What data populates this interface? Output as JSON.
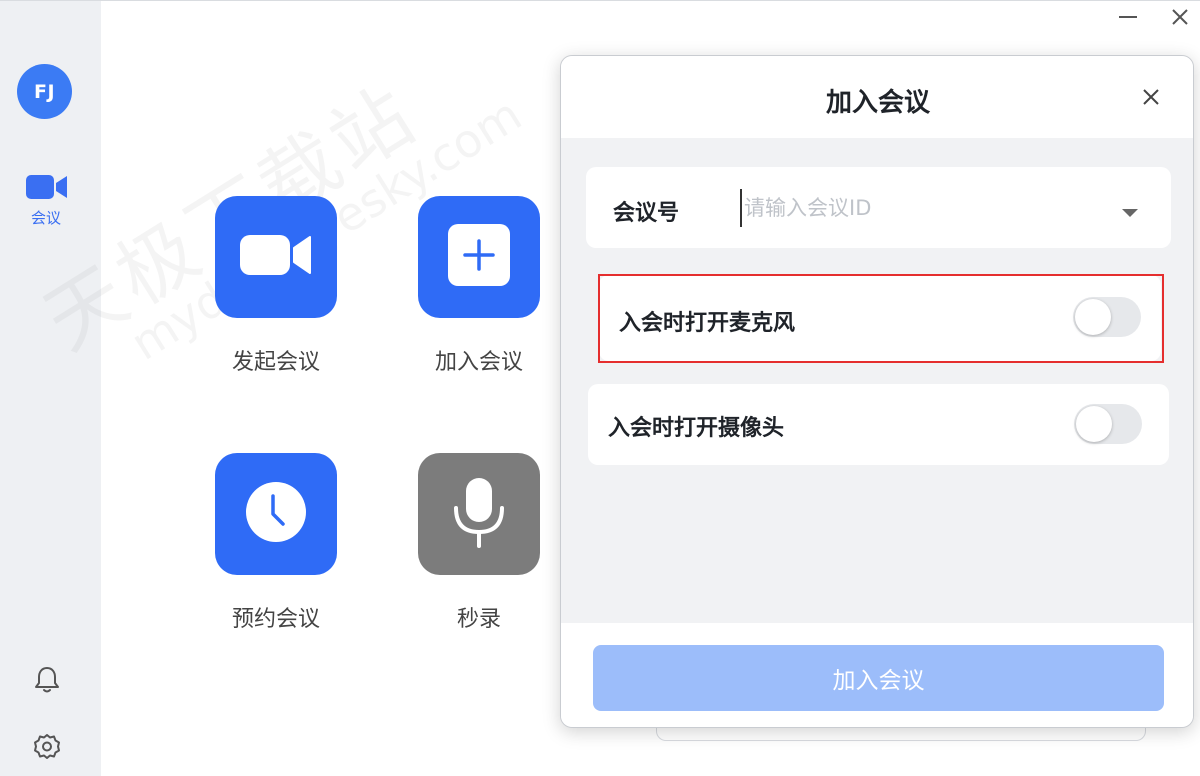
{
  "sidebar": {
    "avatar_initials": "FJ",
    "nav_meeting_label": "会议",
    "accent_color": "#3a6ff2",
    "icons": [
      "video-camera-icon",
      "bell-icon",
      "gear-icon"
    ]
  },
  "window_controls": [
    "minimize-icon",
    "close-icon"
  ],
  "main": {
    "tiles": [
      {
        "label": "发起会议",
        "icon": "video-camera-icon",
        "color": "#2f6bf6"
      },
      {
        "label": "加入会议",
        "icon": "plus-icon",
        "color": "#2f6bf6"
      },
      {
        "label": "预约会议",
        "icon": "clock-icon",
        "color": "#2f6bf6"
      },
      {
        "label": "秒录",
        "icon": "microphone-icon",
        "color": "#7c7c7c"
      }
    ]
  },
  "dialog": {
    "title": "加入会议",
    "meeting_id_label": "会议号",
    "meeting_id_value": "",
    "meeting_id_placeholder": "请输入会议ID",
    "mic_option_label": "入会时打开麦克风",
    "mic_enabled": false,
    "camera_option_label": "入会时打开摄像头",
    "camera_enabled": false,
    "join_button_label": "加入会议",
    "join_button_color": "#9cbdfa",
    "highlight_color": "#e52e2e"
  },
  "watermark": {
    "line1": "天极下载站",
    "line2": "mydown.yesky.com"
  }
}
